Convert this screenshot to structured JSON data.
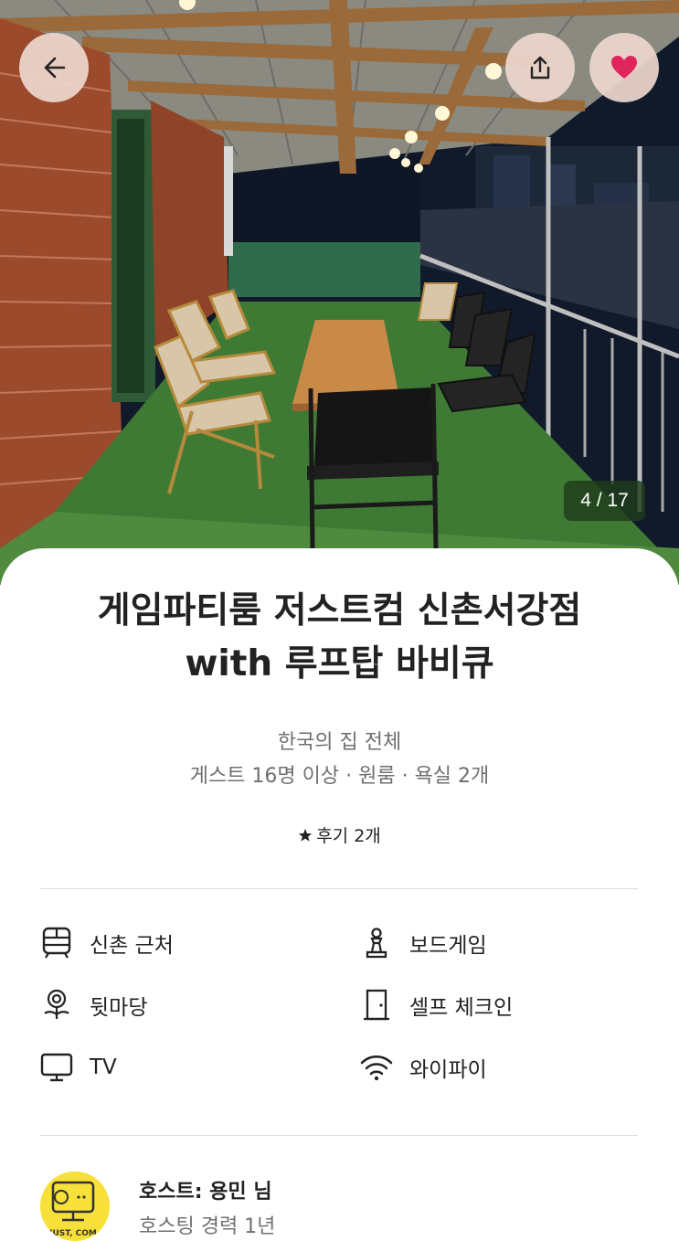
{
  "listing": {
    "title_line1": "게임파티룸 저스트컴 신촌서강점",
    "title_line2": "with 루프탑 바비큐",
    "subtitle": "한국의 집 전체",
    "details": "게스트 16명 이상 · 원룸 · 욕실 2개",
    "reviews": "후기 2개",
    "photo_counter": "4 / 17"
  },
  "amenities": [
    {
      "label": "신촌 근처",
      "icon": "subway-icon"
    },
    {
      "label": "보드게임",
      "icon": "chess-pawn-icon"
    },
    {
      "label": "뒷마당",
      "icon": "backyard-flower-icon"
    },
    {
      "label": "셀프 체크인",
      "icon": "door-icon"
    },
    {
      "label": "TV",
      "icon": "tv-icon"
    },
    {
      "label": "와이파이",
      "icon": "wifi-icon"
    }
  ],
  "host": {
    "name": "호스트: 용민 님",
    "experience": "호스팅 경력 1년",
    "avatar_text": "JUST, COM"
  },
  "colors": {
    "like_heart": "#e0245e",
    "header_button_bg": "#ecd6cc",
    "counter_bg": "#1e3c1c",
    "text_primary": "#222222",
    "text_secondary": "#6f6f6f",
    "avatar_bg": "#f8e03a"
  }
}
